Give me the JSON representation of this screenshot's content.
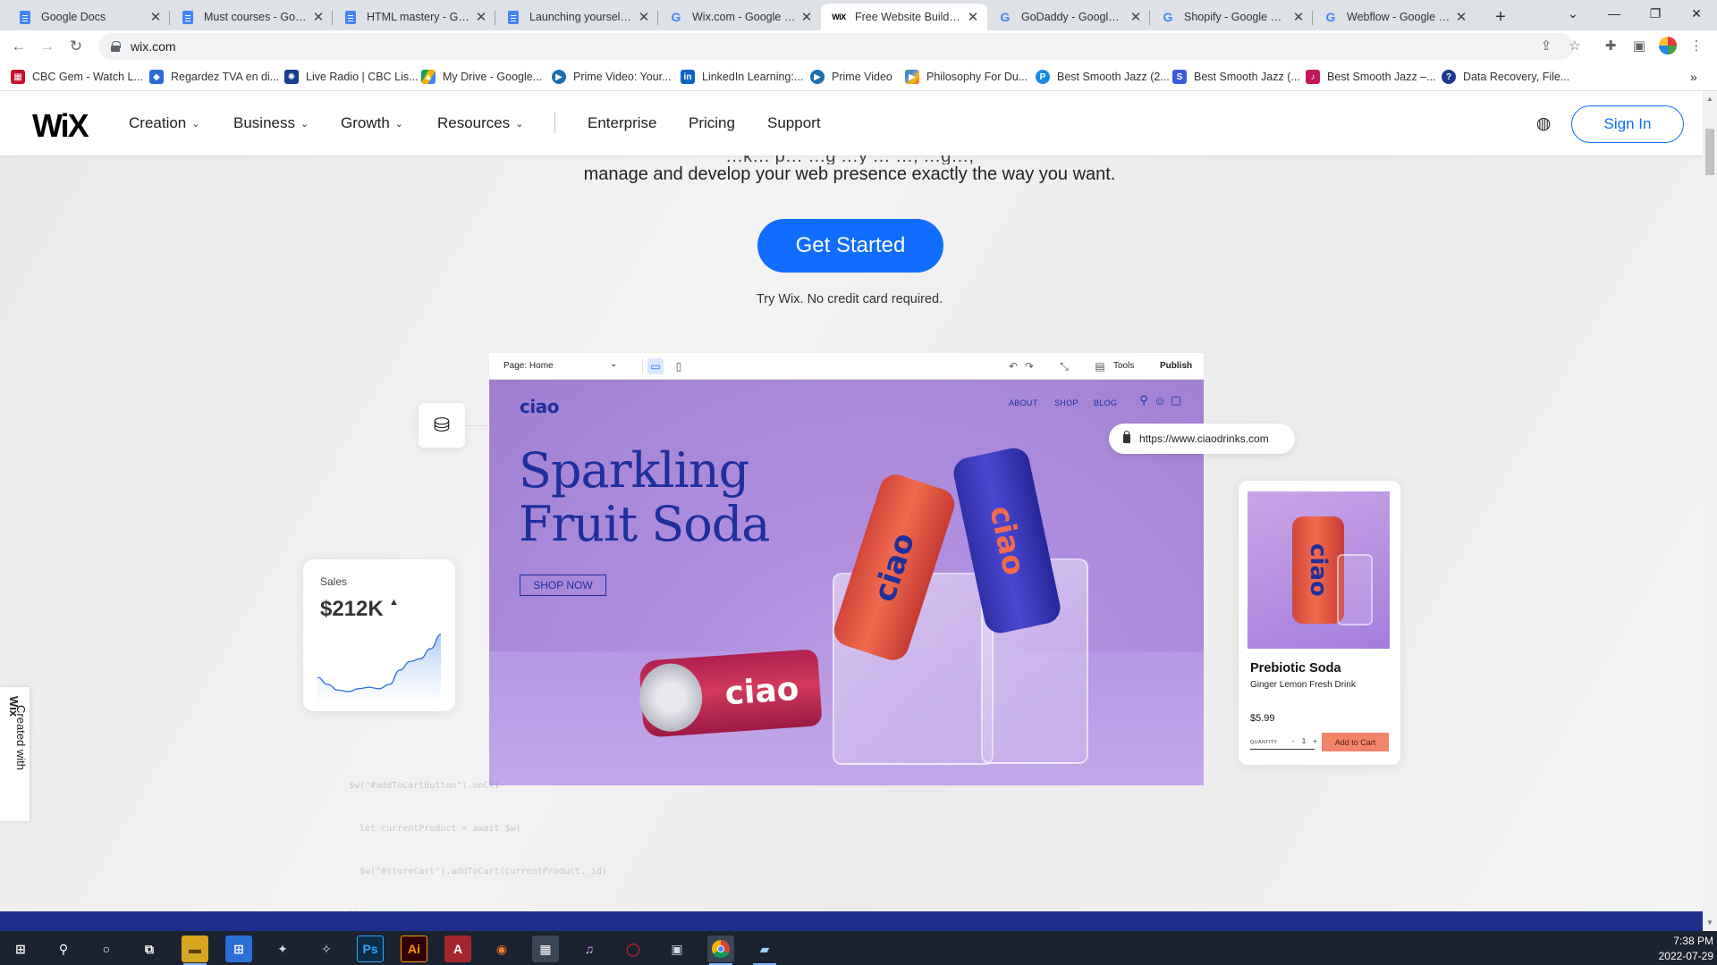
{
  "browser": {
    "tabs": [
      {
        "title": "Google Docs",
        "icon": "docs-icon",
        "active": false
      },
      {
        "title": "Must courses - Google Docs",
        "icon": "docs-icon",
        "active": false
      },
      {
        "title": "HTML mastery - Google Docs",
        "icon": "docs-icon",
        "active": false
      },
      {
        "title": "Launching yourself - Google Docs",
        "icon": "docs-icon",
        "active": false
      },
      {
        "title": "Wix.com - Google Search",
        "icon": "google-icon",
        "active": false
      },
      {
        "title": "Free Website Builder | Create a Free Website",
        "icon": "wix-icon",
        "active": true
      },
      {
        "title": "GoDaddy - Google Search",
        "icon": "google-icon",
        "active": false
      },
      {
        "title": "Shopify - Google Search",
        "icon": "google-icon",
        "active": false
      },
      {
        "title": "Webflow - Google Search",
        "icon": "google-icon",
        "active": false
      }
    ],
    "url": "wix.com",
    "bookmarks": [
      {
        "label": "CBC Gem - Watch L...",
        "color": "#c8102e"
      },
      {
        "label": "Regardez TVA en di...",
        "color": "#2b6cd4"
      },
      {
        "label": "Live Radio | CBC Lis...",
        "color": "#1a3e8c"
      },
      {
        "label": "My Drive - Google...",
        "color": "#f4b400"
      },
      {
        "label": "Prime Video: Your...",
        "color": "#1a6fb0"
      },
      {
        "label": "LinkedIn Learning:...",
        "color": "#0a66c2"
      },
      {
        "label": "Prime Video",
        "color": "#1a6fb0"
      },
      {
        "label": "Philosophy For Du...",
        "color": "#34a853"
      },
      {
        "label": "Best Smooth Jazz (2...",
        "color": "#1e88e5"
      },
      {
        "label": "Best Smooth Jazz (...",
        "color": "#3b5bdb"
      },
      {
        "label": "Best Smooth Jazz –...",
        "color": "#c2185b"
      },
      {
        "label": "Data Recovery, File...",
        "color": "#1e3a8a"
      }
    ]
  },
  "wix": {
    "logo": "WiX",
    "nav": [
      {
        "label": "Creation",
        "dropdown": true
      },
      {
        "label": "Business",
        "dropdown": true
      },
      {
        "label": "Growth",
        "dropdown": true
      },
      {
        "label": "Resources",
        "dropdown": true
      },
      {
        "label": "Enterprise",
        "dropdown": false
      },
      {
        "label": "Pricing",
        "dropdown": false
      },
      {
        "label": "Support",
        "dropdown": false
      }
    ],
    "sign_in": "Sign In",
    "hero_line1": "…k… p… …g …y … …, …g…,",
    "hero_line2": "manage and develop your web presence exactly the way you want.",
    "cta": "Get Started",
    "cta_note": "Try Wix. No credit card required.",
    "accent": "#116dff"
  },
  "editor": {
    "page_select": "Page: Home",
    "tools": "Tools",
    "publish": "Publish"
  },
  "site": {
    "logo": "ciao",
    "nav": [
      "ABOUT",
      "SHOP",
      "BLOG"
    ],
    "title_line1": "Sparkling",
    "title_line2": "Fruit Soda",
    "shop_now": "SHOP NOW",
    "can_text": "ciao",
    "url": "https://www.ciaodrinks.com",
    "brand_color": "#1f2f9b"
  },
  "sales": {
    "label": "Sales",
    "value": "$212K",
    "trend": [
      40,
      30,
      22,
      20,
      24,
      26,
      24,
      30,
      50,
      62,
      66,
      80,
      100
    ]
  },
  "code_snippet": [
    "$w(\"#addToCartButton\").onCli",
    "  let currentProduct = await $w(",
    "  $w(\"#storeCart\").addToCart(currentProduct._id)",
    "})"
  ],
  "product": {
    "name": "Prebiotic Soda",
    "subtitle": "Ginger Lemon Fresh Drink",
    "price": "$5.99",
    "quantity_label": "QUANTITY",
    "quantity": "1",
    "add_to_cart": "Add to Cart"
  },
  "created_with": {
    "prefix": "Created with",
    "brand": "Wix"
  },
  "taskbar": {
    "time": "7:38 PM",
    "date": "2022-07-29"
  }
}
